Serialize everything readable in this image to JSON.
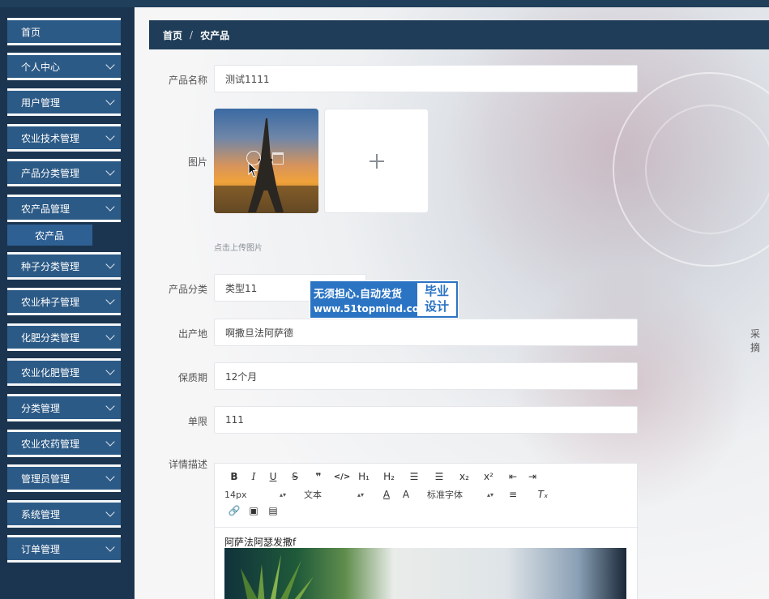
{
  "sidebar": {
    "items": [
      {
        "label": "首页",
        "has_arrow": false
      },
      {
        "label": "个人中心",
        "has_arrow": true
      },
      {
        "label": "用户管理",
        "has_arrow": true
      },
      {
        "label": "农业技术管理",
        "has_arrow": true
      },
      {
        "label": "产品分类管理",
        "has_arrow": true
      },
      {
        "label": "农产品管理",
        "has_arrow": true
      },
      {
        "label": "种子分类管理",
        "has_arrow": true
      },
      {
        "label": "农业种子管理",
        "has_arrow": true
      },
      {
        "label": "化肥分类管理",
        "has_arrow": true
      },
      {
        "label": "农业化肥管理",
        "has_arrow": true
      },
      {
        "label": "分类管理",
        "has_arrow": true
      },
      {
        "label": "农业农药管理",
        "has_arrow": true
      },
      {
        "label": "管理员管理",
        "has_arrow": true
      },
      {
        "label": "系统管理",
        "has_arrow": true
      },
      {
        "label": "订单管理",
        "has_arrow": true
      }
    ],
    "submenu": {
      "label": "农产品"
    }
  },
  "breadcrumb": {
    "home": "首页",
    "separator": "/",
    "current": "农产品"
  },
  "form": {
    "name_label": "产品名称",
    "name_value": "测试1111",
    "image_label": "图片",
    "upload_hint": "点击上传图片",
    "category_label": "产品分类",
    "category_value": "类型11",
    "origin_label": "出产地",
    "origin_value": "啊撒旦法阿萨德",
    "shelf_label": "保质期",
    "shelf_value": "12个月",
    "price_label": "单限",
    "price_value": "111",
    "detail_label": "详情描述",
    "cutoff_label": "采摘"
  },
  "watermark": {
    "line1": "无须担心.自动发货",
    "line2": "www.51topmind.com",
    "badge_line1": "毕业",
    "badge_line2": "设计"
  },
  "editor": {
    "font_size": "14px",
    "text_type": "文本",
    "font_family": "标准字体",
    "content_text": "阿萨法阿瑟发撒f"
  },
  "colors": {
    "sidebar_bg": "#1b3550",
    "menu_item_bg": "#2c5a86",
    "breadcrumb_bg": "#1f3d58",
    "watermark_bg": "#2b74c4"
  }
}
